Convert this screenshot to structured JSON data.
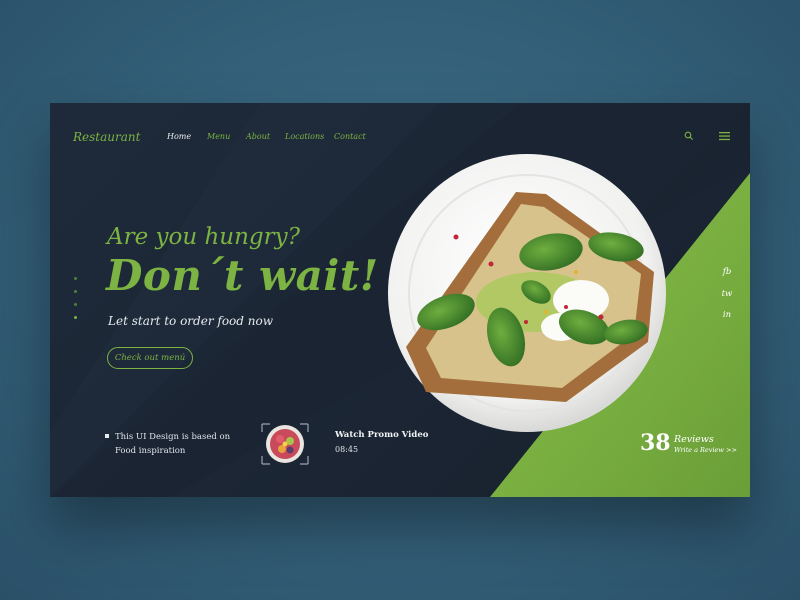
{
  "brand": "Restaurant",
  "nav": {
    "items": [
      {
        "label": "Home",
        "active": true
      },
      {
        "label": "Menu",
        "active": false
      },
      {
        "label": "About",
        "active": false
      },
      {
        "label": "Locations",
        "active": false
      },
      {
        "label": "Contact",
        "active": false
      }
    ]
  },
  "hero": {
    "line1": "Are you hungry?",
    "line2": "Don´t wait!",
    "subline": "Let start to order food now",
    "cta": "Check out menú"
  },
  "info": {
    "line1": "This UI Design is based on",
    "line2": "Food inspiration"
  },
  "video": {
    "title": "Watch Promo Video",
    "time": "08:45"
  },
  "social": [
    "fb",
    "tw",
    "in"
  ],
  "reviews": {
    "count": "38",
    "label": "Reviews",
    "link": "Write a Review >>"
  },
  "colors": {
    "accent": "#7cb342",
    "panel": "#1e2a3a",
    "background": "#3a6a84"
  },
  "icons": [
    "search-icon",
    "menu-icon",
    "play-thumbnail"
  ]
}
